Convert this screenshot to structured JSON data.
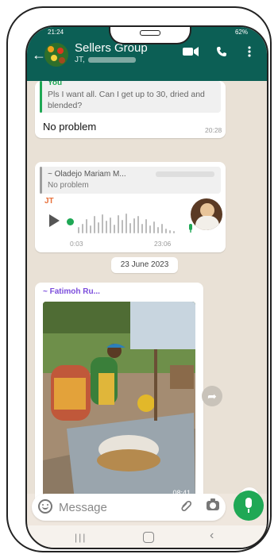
{
  "status": {
    "time": "21:24",
    "battery": "62%"
  },
  "header": {
    "title": "Sellers Group",
    "subtitle": "JT,"
  },
  "messages": [
    {
      "reply_author": "You",
      "reply_text": "Pls I want all. Can I get up to 30, dried and blended?",
      "text": "No problem",
      "time": "20:28"
    },
    {
      "reply_author": "~ Oladejo Mariam M...",
      "reply_text": "No problem",
      "sender": "JT",
      "voice_elapsed": "0:03",
      "time": "23:06"
    }
  ],
  "date_separator": "23 June 2023",
  "image_message": {
    "sender": "~ Fatimoh Ru...",
    "time": "08:41"
  },
  "composer": {
    "placeholder": "Message"
  },
  "colors": {
    "header": "#0c5f55",
    "accent": "#1fa855",
    "chat_bg": "#e9e1d6"
  }
}
